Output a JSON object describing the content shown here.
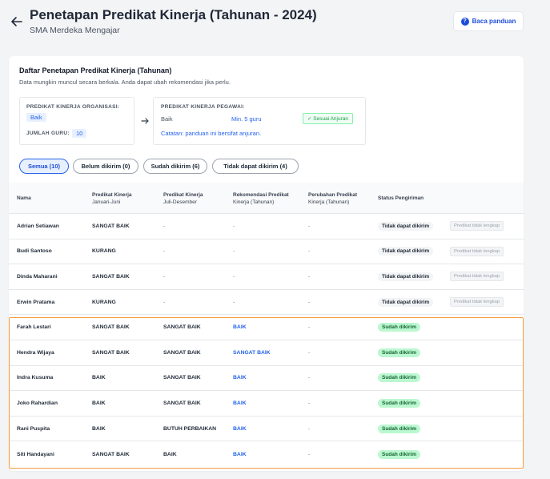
{
  "header": {
    "title": "Penetapan Predikat Kinerja (Tahunan - 2024)",
    "subtitle": "SMA Merdeka Mengajar",
    "guide_label": "Baca panduan"
  },
  "card": {
    "title": "Daftar Penetapan Predikat Kinerja (Tahunan)",
    "description": "Data mungkin muncul secara berkala. Anda dapat ubah rekomendasi jika perlu."
  },
  "org_box": {
    "label": "PREDIKAT KINERJA ORGANISASI:",
    "value": "Baik",
    "count_label": "JUMLAH GURU:",
    "count_value": "10"
  },
  "emp_box": {
    "label": "PREDIKAT KINERJA PEGAWAI:",
    "value": "Baik",
    "min": "Min. 5 guru",
    "badge": "✓ Sesuai Anjuran",
    "note": "Catatan: panduan ini bersifat anjuran."
  },
  "tabs": [
    {
      "label": "Semua (10)"
    },
    {
      "label": "Belum dikirim (0)"
    },
    {
      "label": "Sudah dikirim (6)"
    },
    {
      "label": "Tidak dapat dikirim (4)"
    }
  ],
  "columns": [
    {
      "line1": "Nama",
      "line2": ""
    },
    {
      "line1": "Predikat Kinerja",
      "line2": "Januari-Juni"
    },
    {
      "line1": "Predikat Kinerja",
      "line2": "Juli-Desember"
    },
    {
      "line1": "Rekomendasi Predikat",
      "line2": "Kinerja (Tahunan)"
    },
    {
      "line1": "Perubahan Predikat",
      "line2": "Kinerja (Tahunan)"
    },
    {
      "line1": "Status Pengiriman",
      "line2": ""
    }
  ],
  "rows": [
    {
      "name": "Adrian Setiawan",
      "jan_jun": "SANGAT BAIK",
      "jul_des": "-",
      "rekomendasi": "-",
      "perubahan": "-",
      "status": "Tidak dapat dikirim",
      "note": "Predikat tidak lengkap"
    },
    {
      "name": "Budi Santoso",
      "jan_jun": "KURANG",
      "jul_des": "-",
      "rekomendasi": "-",
      "perubahan": "-",
      "status": "Tidak dapat dikirim",
      "note": "Predikat tidak lengkap"
    },
    {
      "name": "Dinda Maharani",
      "jan_jun": "SANGAT BAIK",
      "jul_des": "-",
      "rekomendasi": "-",
      "perubahan": "-",
      "status": "Tidak dapat dikirim",
      "note": "Predikat tidak lengkap"
    },
    {
      "name": "Erwin Pratama",
      "jan_jun": "KURANG",
      "jul_des": "-",
      "rekomendasi": "-",
      "perubahan": "-",
      "status": "Tidak dapat dikirim",
      "note": "Predikat tidak lengkap"
    },
    {
      "name": "Farah Lestari",
      "jan_jun": "SANGAT BAIK",
      "jul_des": "SANGAT BAIK",
      "rekomendasi": "BAIK",
      "perubahan": "-",
      "status": "Sudah dikirim",
      "note": ""
    },
    {
      "name": "Hendra Wijaya",
      "jan_jun": "SANGAT BAIK",
      "jul_des": "SANGAT BAIK",
      "rekomendasi": "SANGAT BAIK",
      "perubahan": "-",
      "status": "Sudah dikirim",
      "note": ""
    },
    {
      "name": "Indra Kusuma",
      "jan_jun": "BAIK",
      "jul_des": "SANGAT BAIK",
      "rekomendasi": "BAIK",
      "perubahan": "-",
      "status": "Sudah dikirim",
      "note": ""
    },
    {
      "name": "Joko Rahardian",
      "jan_jun": "BAIK",
      "jul_des": "SANGAT BAIK",
      "rekomendasi": "BAIK",
      "perubahan": "-",
      "status": "Sudah dikirim",
      "note": ""
    },
    {
      "name": "Rani Puspita",
      "jan_jun": "BAIK",
      "jul_des": "BUTUH PERBAIKAN",
      "rekomendasi": "BAIK",
      "perubahan": "-",
      "status": "Sudah dikirim",
      "note": ""
    },
    {
      "name": "Siti Handayani",
      "jan_jun": "SANGAT BAIK",
      "jul_des": "BAIK",
      "rekomendasi": "BAIK",
      "perubahan": "-",
      "status": "Sudah dikirim",
      "note": ""
    }
  ],
  "colors": {
    "accent": "#2563eb",
    "highlight_border": "#f59e42",
    "sent_badge": "#bbf7d0"
  }
}
